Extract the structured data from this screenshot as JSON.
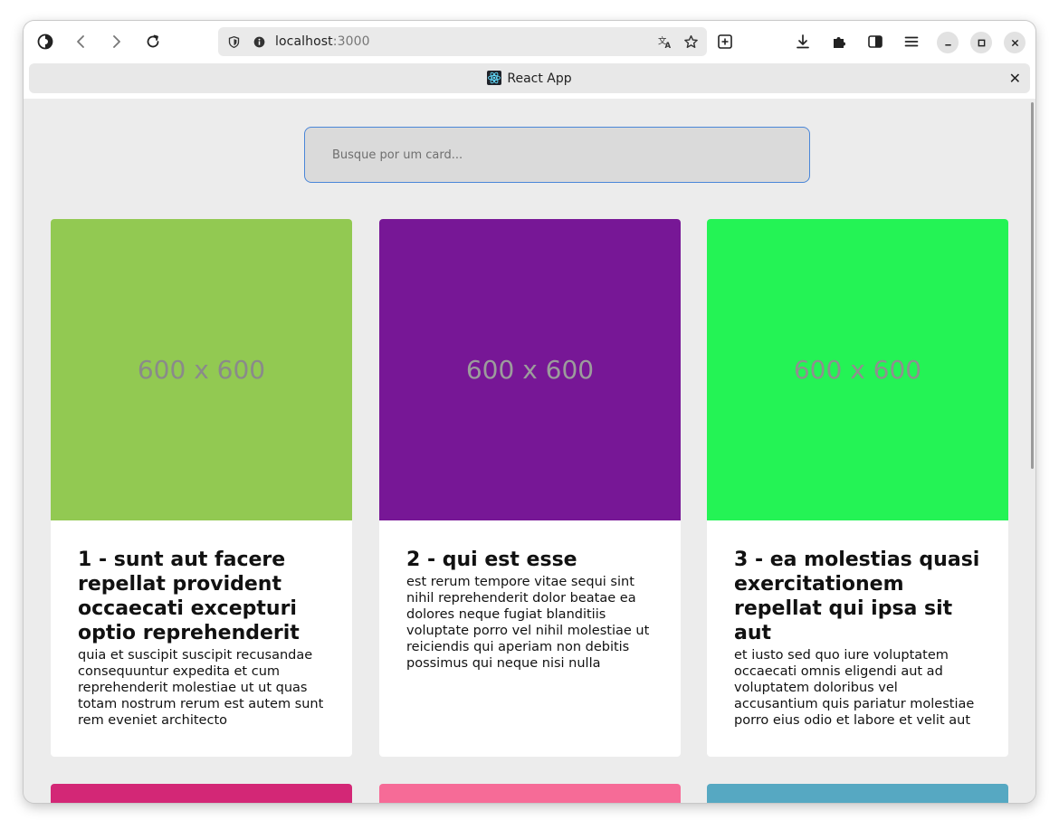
{
  "browser": {
    "url_host": "localhost",
    "url_port": ":3000",
    "tab_title": "React App",
    "tab_close": "✕",
    "icons": [
      "firefox-view-icon",
      "back-icon",
      "forward-icon",
      "reload-icon",
      "shield-icon",
      "info-icon",
      "translate-icon",
      "bookmark-star-icon",
      "new-tab-icon",
      "download-icon",
      "extensions-icon",
      "sidebar-icon",
      "menu-icon",
      "minimize-icon",
      "maximize-icon",
      "close-icon"
    ]
  },
  "search": {
    "placeholder": "Busque por um card...",
    "value": ""
  },
  "cards": [
    {
      "image_label": "600 x 600",
      "image_color": "#92c952",
      "label_color": "#8a8a8a",
      "title": "1 - sunt aut facere repellat provident occaecati excepturi optio reprehenderit",
      "body": "quia et suscipit suscipit recusandae consequuntur expedita et cum reprehenderit molestiae ut ut quas totam nostrum rerum est autem sunt rem eveniet architecto"
    },
    {
      "image_label": "600 x 600",
      "image_color": "#771796",
      "label_color": "#9c9c9c",
      "title": "2 - qui est esse",
      "body": "est rerum tempore vitae sequi sint nihil reprehenderit dolor beatae ea dolores neque fugiat blanditiis voluptate porro vel nihil molestiae ut reiciendis qui aperiam non debitis possimus qui neque nisi nulla"
    },
    {
      "image_label": "600 x 600",
      "image_color": "#24f355",
      "label_color": "#8f8f8f",
      "title": "3 - ea molestias quasi exercitationem repellat qui ipsa sit aut",
      "body": "et iusto sed quo iure voluptatem occaecati omnis eligendi aut ad voluptatem doloribus vel accusantium quis pariatur molestiae porro eius odio et labore et velit aut"
    }
  ],
  "partial_cards": [
    {
      "image_color": "#d32776"
    },
    {
      "image_color": "#f66b97"
    },
    {
      "image_color": "#56a8c2"
    }
  ]
}
